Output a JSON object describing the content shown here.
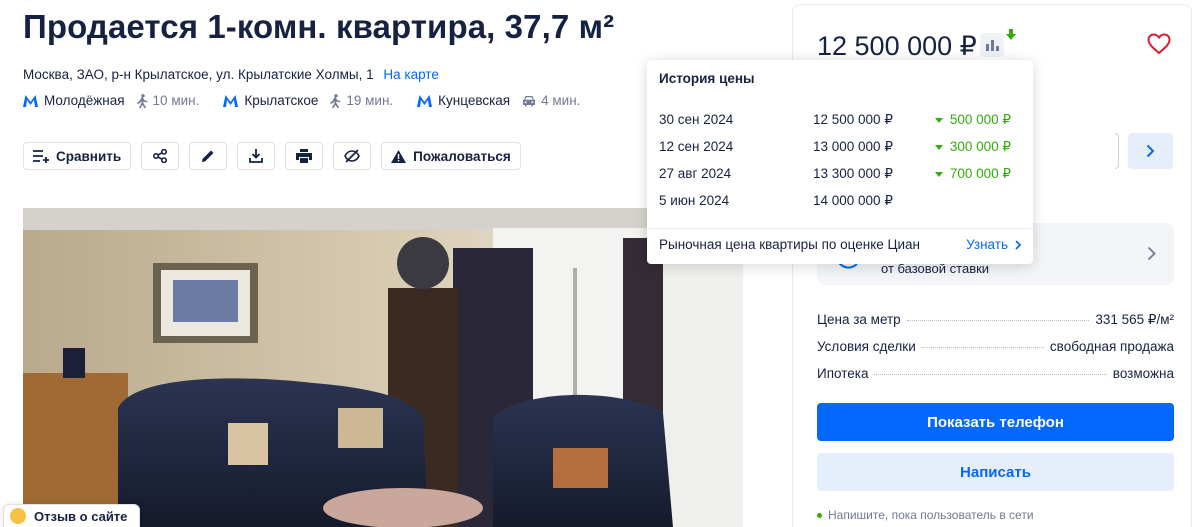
{
  "listing": {
    "title": "Продается 1-комн. квартира, 37,7 м²",
    "address": "Москва, ЗАО, р-н Крылатское, ул. Крылатские Холмы, 1",
    "map_link": "На карте",
    "metro": [
      {
        "station": "Молодёжная",
        "time": "10 мин.",
        "mode": "walk"
      },
      {
        "station": "Крылатское",
        "time": "19 мин.",
        "mode": "walk"
      },
      {
        "station": "Кунцевская",
        "time": "4 мин.",
        "mode": "car"
      }
    ]
  },
  "toolbar": {
    "compare_label": "Сравнить",
    "complain_label": "Пожаловаться",
    "icons": [
      "compare-icon",
      "share-icon",
      "pencil-icon",
      "download-icon",
      "print-icon",
      "hide-icon",
      "warning-icon"
    ]
  },
  "feedback": {
    "label": "Отзыв о сайте"
  },
  "sidebar": {
    "price": "12 500 000 ₽",
    "promo_text": "от базовой ставки",
    "facts": [
      {
        "label": "Цена за метр",
        "value": "331 565 ₽/м²"
      },
      {
        "label": "Условия сделки",
        "value": "свободная продажа"
      },
      {
        "label": "Ипотека",
        "value": "возможна"
      }
    ],
    "show_phone_label": "Показать телефон",
    "write_label": "Написать",
    "online_hint": "Напишите, пока пользователь в сети"
  },
  "price_history": {
    "title": "История цены",
    "rows": [
      {
        "date": "30 сен 2024",
        "price": "12 500 000 ₽",
        "change": "500 000 ₽"
      },
      {
        "date": "12 сен 2024",
        "price": "13 000 000 ₽",
        "change": "300 000 ₽"
      },
      {
        "date": "27 авг 2024",
        "price": "13 300 000 ₽",
        "change": "700 000 ₽"
      },
      {
        "date": "5 июн 2024",
        "price": "14 000 000 ₽",
        "change": ""
      }
    ],
    "market_text": "Рыночная цена квартиры по оценке Циан",
    "market_link": "Узнать"
  },
  "colors": {
    "accent": "#0468ff",
    "text": "#152242",
    "muted": "#707a95",
    "positive": "#34ac0a"
  }
}
